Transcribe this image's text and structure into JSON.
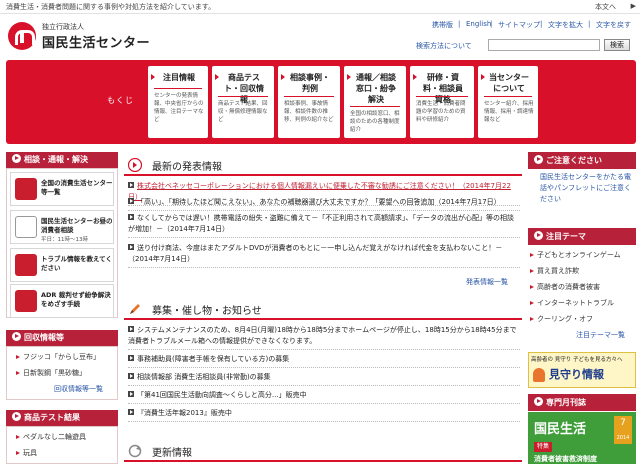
{
  "topbar": {
    "tagline": "消費生活・消費者問題に関する事例や対処方法を紹介しています。",
    "skip": "本文へ"
  },
  "logo": {
    "small": "独立行政法人",
    "big": "国民生活センター"
  },
  "utility": {
    "mobile": "携帯版",
    "english": "English",
    "sitemap": "サイトマップ",
    "text_size": "文字を拡大",
    "text_reset": "文字を戻す",
    "search_how": "検索方法について",
    "search_placeholder": "",
    "search_button": "検索"
  },
  "mokuji": {
    "label": "もくじ",
    "items": [
      {
        "title": "注目情報",
        "desc": "センターの発表情報、中央省庁からの情報、注目テーマなど"
      },
      {
        "title": "商品テスト・回収情報",
        "desc": "商品テスト結果、回収・無償修理情報など"
      },
      {
        "title": "相談事例・判例",
        "desc": "相談事例、事故情報、相談件数の推移、判例の紹介など"
      },
      {
        "title": "通報／相談窓口・紛争解決",
        "desc": "全国の相談窓口、相談のための各種制度紹介"
      },
      {
        "title": "研修・資料・相談員資格",
        "desc": "消費生活・消費者問題の学習のための資料や研修紹介"
      },
      {
        "title": "当センターについて",
        "desc": "センター紹介、採用情報、採用・調達情報など"
      }
    ]
  },
  "left": {
    "consult_head": "相談・通報・解決",
    "cards": [
      {
        "title": "全国の消費生活センター等一覧",
        "sub": ""
      },
      {
        "title": "国民生活センターお昼の消費者相談",
        "sub": "平日：11時〜13時"
      },
      {
        "title": "トラブル情報を教えてください",
        "sub": ""
      },
      {
        "title": "ADR 裁判せず紛争解決をめざす手続",
        "sub": ""
      }
    ],
    "recall_head": "回収情報等",
    "recall_items": [
      "フジッコ「からし豆布」",
      "日新製鋼「黒砂糖」"
    ],
    "recall_more": "回収情報等一覧",
    "test_head": "商品テスト結果",
    "test_items": [
      "ペダルなし二輪遊具",
      "玩具"
    ]
  },
  "center": {
    "news_head": "最新の発表情報",
    "news_items": [
      "株式会社ベネッセコーポレーションにおける個人情報漏えいに便乗した不審な勧誘にご注意ください！（2014年7月22日）",
      "「高い」、「期待したほど聞こえない」、あなたの補聴器選び大丈夫ですか？「要望への回答追加（2014年7月17日）",
      "なくしてからでは遅い！携帯電話の紛失・盗難に備えて－「不正利用されて高額請求」、「データの流出が心配」等の相談が増加！－（2014年7月14日）",
      "送り付け商法、今度はまたアダルトDVDが消費者のもとに－一申し込んだ覚えがなければ代金を支払わないこと！－（2014年7月14日）"
    ],
    "news_more": "発表情報一覧",
    "event_head": "募集・催し物・お知らせ",
    "event_items": [
      "システムメンテナンスのため、8月4日(月曜)18時から18時5分までホームページが停止し、18時15分から18時45分まで消費者トラブルメール箱への情報提供ができなくなります。",
      "事務補助員(障害者手帳を保有している方)の募集",
      "相談情報部 消費生活相談員(非常勤)の募集",
      "「第41回国民生活動向調査～くらしと高分...」販売中",
      "『消費生活年報2013』販売中"
    ],
    "update_head": "更新情報"
  },
  "right": {
    "caution_head": "ご注意ください",
    "caution_text": "国民生活センターをかたる電話やパンフレットにご注意ください",
    "theme_head": "注目テーマ",
    "theme_items": [
      "子どもとオンラインゲーム",
      "買え買え詐欺",
      "高齢者の消費者被害",
      "インターネットトラブル",
      "クーリング・オフ"
    ],
    "theme_more": "注目テーマ一覧",
    "banner_top": "高齢者の 見守り 子どもを見る方々へ",
    "banner_main": "見守り情報",
    "monthly_head": "専門月刊誌",
    "magazine_title": "国民生活",
    "magazine_num": "7",
    "magazine_year": "2014",
    "magazine_badge": "特集",
    "magazine_sub": "消費者被害救済制度"
  },
  "colors": {
    "accent": "#d8102a",
    "side_head": "#b7223a",
    "link": "#2a57a7"
  }
}
